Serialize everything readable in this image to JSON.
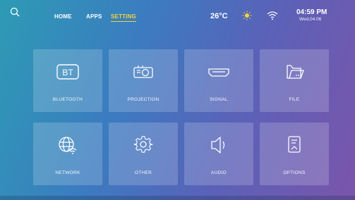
{
  "nav": {
    "home": "HOME",
    "apps": "APPS",
    "setting": "SETTING"
  },
  "status": {
    "temperature": "26°C",
    "time": "04:59 PM",
    "date": "Wed,04.06"
  },
  "tiles": [
    {
      "label": "BLUETOOTH",
      "icon": "bluetooth-icon",
      "icon_text": "BT"
    },
    {
      "label": "PROJECTION",
      "icon": "projector-icon"
    },
    {
      "label": "SIGNAL",
      "icon": "hdmi-signal-icon"
    },
    {
      "label": "FILE",
      "icon": "folder-icon"
    },
    {
      "label": "NETWORK",
      "icon": "network-globe-icon"
    },
    {
      "label": "OTHER",
      "icon": "gear-icon"
    },
    {
      "label": "AUDIO",
      "icon": "speaker-icon"
    },
    {
      "label": "OPTIONS",
      "icon": "options-document-icon"
    }
  ],
  "colors": {
    "accent": "#f5d33a",
    "background_start": "#2d9bb5",
    "background_end": "#7a55ab"
  }
}
